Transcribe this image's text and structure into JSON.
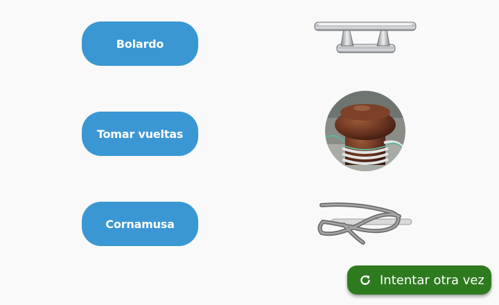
{
  "terms": [
    {
      "label": "Bolardo",
      "icon": "cleat-icon"
    },
    {
      "label": "Tomar vueltas",
      "icon": "bollard-with-rope-photo"
    },
    {
      "label": "Cornamusa",
      "icon": "rope-on-cleat-icon"
    }
  ],
  "retry": {
    "label": "Intentar otra vez",
    "icon": "refresh-icon"
  },
  "colors": {
    "label_button": "#3b97d3",
    "retry_button": "#2e7a1f",
    "background": "#f9f9f9"
  }
}
